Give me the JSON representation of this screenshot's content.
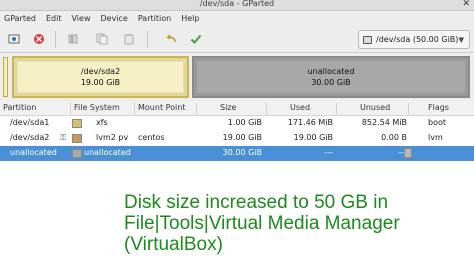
{
  "window": {
    "title": "/dev/sda - GParted",
    "close_glyph": "✕"
  },
  "menu": [
    "GParted",
    "Edit",
    "View",
    "Device",
    "Partition",
    "Help"
  ],
  "toolbar": {
    "device_selector": "/dev/sda (50.00 GiB)"
  },
  "disk_map": {
    "partition": {
      "name": "/dev/sda2",
      "size": "19.00 GiB"
    },
    "unallocated": {
      "name": "unallocated",
      "size": "30.00 GiB"
    }
  },
  "table": {
    "headers": [
      "Partition",
      "File System",
      "Mount Point",
      "Size",
      "Used",
      "Unused",
      "Flags"
    ],
    "rows": [
      {
        "partition": "/dev/sda1",
        "fs": "xfs",
        "fs_color": "#d6c070",
        "mount": "",
        "size": "1.00 GiB",
        "used": "171.46 MiB",
        "unused": "852.54 MiB",
        "flags": "boot"
      },
      {
        "partition": "/dev/sda2",
        "fs": "lvm2 pv",
        "fs_color": "#c79a5b",
        "mount": "centos",
        "size": "19.00 GiB",
        "used": "19.00 GiB",
        "unused": "0.00 B",
        "flags": "lvm"
      },
      {
        "partition": "unallocated",
        "fs": "unallocated",
        "fs_color": "#a8a8a8",
        "mount": "",
        "size": "30.00 GiB",
        "used": "---",
        "unused": "---",
        "flags": ""
      }
    ]
  },
  "caption": {
    "line1": "Disk size increased to 50 GB in",
    "line2": "File|Tools|Virtual Media Manager",
    "line3": "(VirtualBox)"
  },
  "colors": {
    "selection": "#4a90d9",
    "caption": "#1c8a1c",
    "partition_fill": "#f6f0c5",
    "unallocated_fill": "#a8a8a8"
  }
}
